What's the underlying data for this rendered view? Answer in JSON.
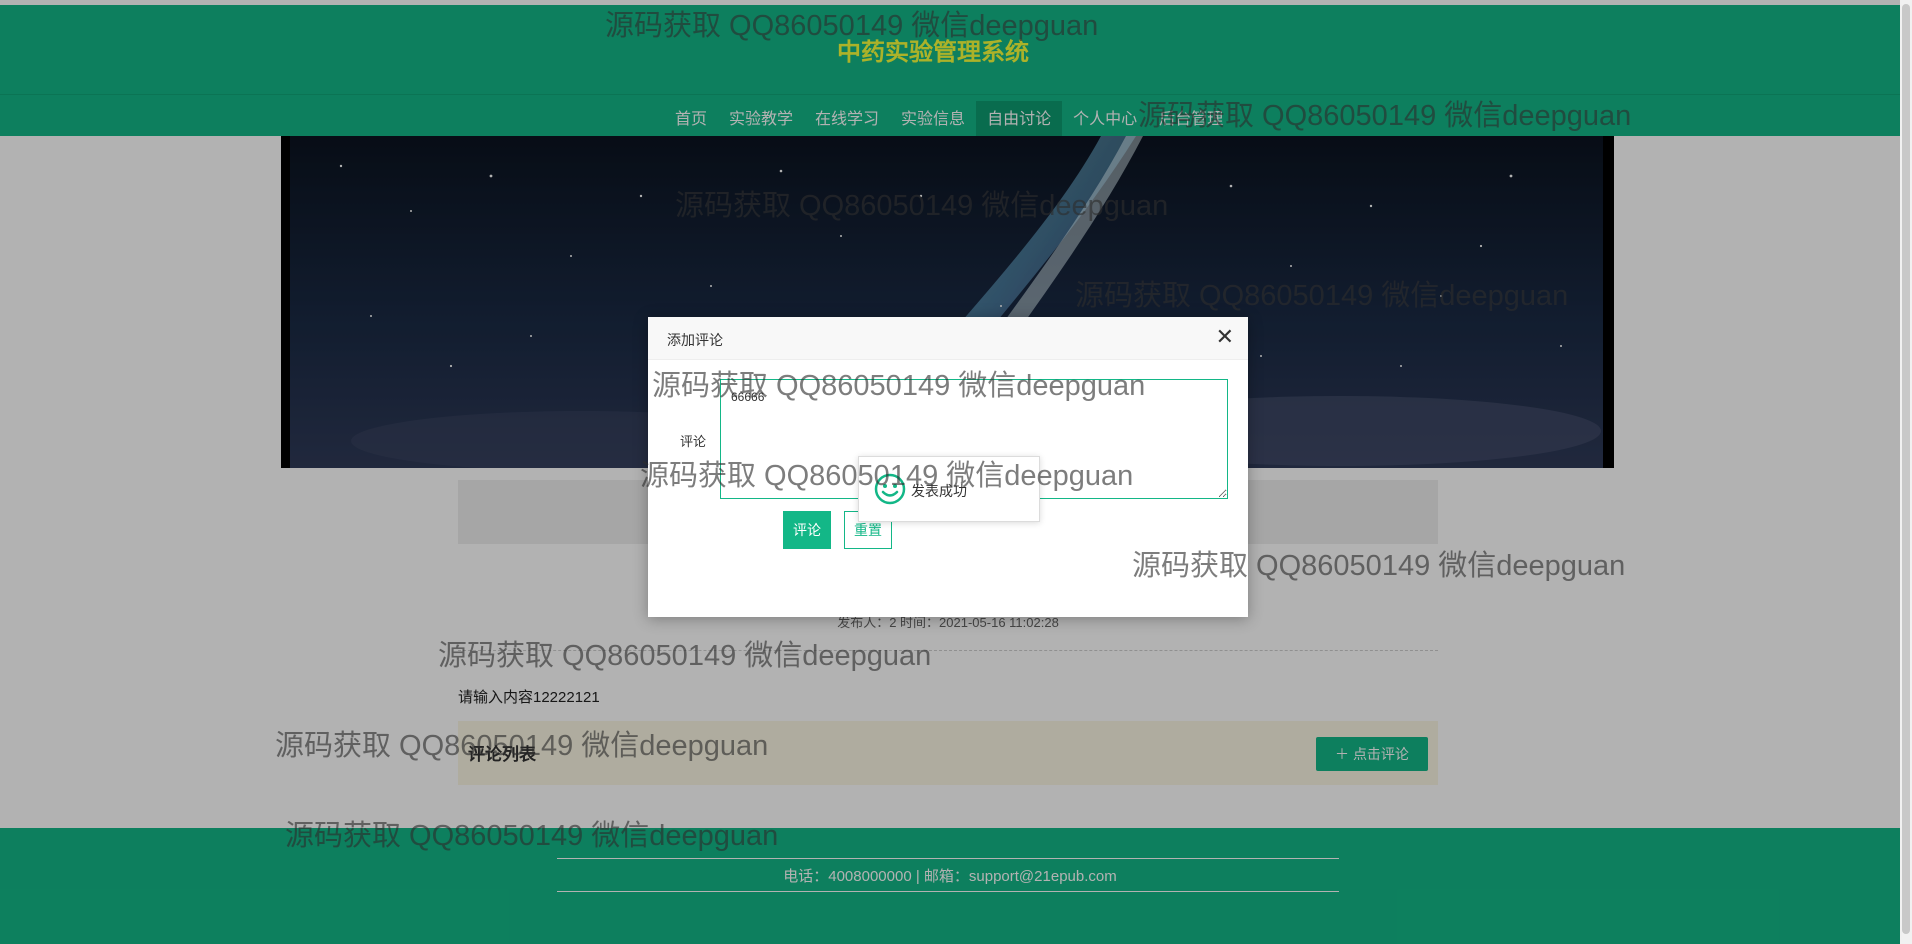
{
  "site": {
    "title": "中药实验管理系统"
  },
  "nav": {
    "items": [
      "首页",
      "实验教学",
      "在线学习",
      "实验信息",
      "自由讨论",
      "个人中心",
      "后台管理"
    ],
    "active": "自由讨论"
  },
  "post": {
    "meta": "发布人：2 时间：2021-05-16 11:02:28",
    "content": "请输入内容12222121"
  },
  "comments": {
    "title": "评论列表",
    "add_label": "点击评论"
  },
  "footer": {
    "text": "电话：4008000000 | 邮箱：support@21epub.com"
  },
  "dialog": {
    "title": "添加评论",
    "field_label": "评论",
    "field_value": "66666",
    "submit_label": "评论",
    "reset_label": "重置"
  },
  "toast": {
    "text": "发表成功"
  },
  "watermark": {
    "text": "源码获取 QQ86050149 微信deepguan"
  },
  "colors": {
    "primary": "#13b787",
    "title": "#f7ff3c",
    "active_nav": "#0e9b70"
  }
}
